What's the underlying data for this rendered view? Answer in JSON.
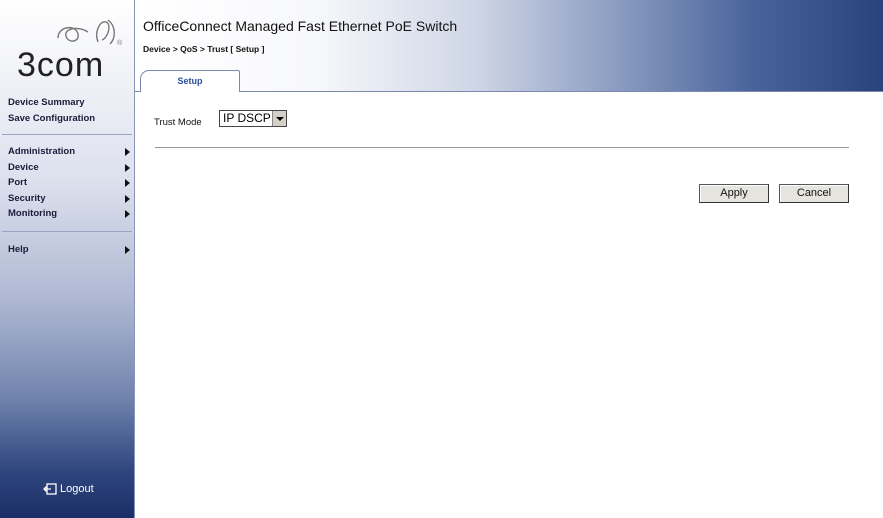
{
  "brand": {
    "logo_text": "3com"
  },
  "header": {
    "title": "OfficeConnect Managed Fast Ethernet PoE Switch",
    "breadcrumb": "Device > QoS > Trust [ Setup ]",
    "tabs": [
      {
        "label": "Setup",
        "active": true
      }
    ]
  },
  "sidebar": {
    "top_links": [
      {
        "label": "Device Summary"
      },
      {
        "label": "Save Configuration"
      }
    ],
    "menu": [
      {
        "label": "Administration",
        "icon": "arrow-right-icon"
      },
      {
        "label": "Device",
        "icon": "arrow-right-icon"
      },
      {
        "label": "Port",
        "icon": "arrow-right-icon"
      },
      {
        "label": "Security",
        "icon": "arrow-right-icon"
      },
      {
        "label": "Monitoring",
        "icon": "arrow-right-icon"
      }
    ],
    "help": {
      "label": "Help",
      "icon": "arrow-right-icon"
    },
    "logout": {
      "label": "Logout",
      "icon": "logout-icon"
    }
  },
  "form": {
    "trust_mode": {
      "label": "Trust Mode",
      "selected": "IP DSCP"
    },
    "apply_label": "Apply",
    "cancel_label": "Cancel"
  },
  "colors": {
    "accent_dark": "#1a2f66",
    "tab_text": "#2a4f9b"
  }
}
